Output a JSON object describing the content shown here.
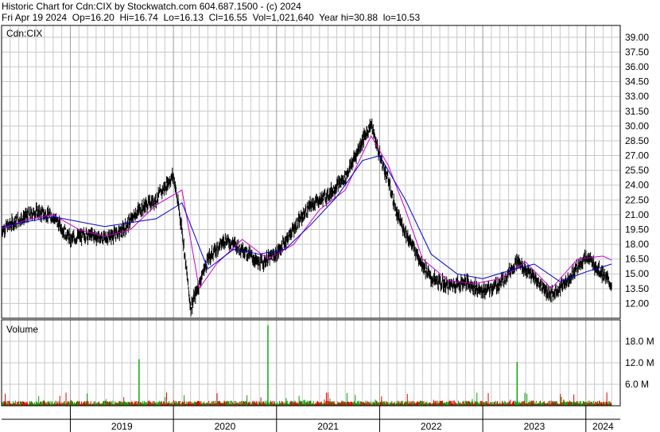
{
  "header": {
    "line1": "Historic Chart for Cdn:CIX by Stockwatch.com 604.687.1500 - (c) 2024",
    "date": "Fri Apr 19 2024",
    "op": "Op=16.20",
    "hi": "Hi=16.74",
    "lo": "Lo=16.13",
    "cl": "Cl=16.55",
    "vol": "Vol=1,021,640",
    "year_hi": "Year hi=30.88",
    "year_lo": "lo=10.53"
  },
  "price_panel": {
    "label": "Cdn:CIX"
  },
  "volume_panel": {
    "label": "Volume"
  },
  "colors": {
    "price_bars": "#000000",
    "ma_short": "#cc00cc",
    "ma_long": "#0000cc",
    "volume_up": "#00a000",
    "volume_down": "#e00000",
    "grid": "#c8c8c8",
    "frame": "#000000"
  },
  "chart_data": [
    {
      "type": "line",
      "title": "Historic Chart for Cdn:CIX",
      "xlabel": "",
      "ylabel": "",
      "x_tick_labels": [
        "2019",
        "2020",
        "2021",
        "2022",
        "2023",
        "2024"
      ],
      "y_tick_labels": [
        "12.00",
        "13.50",
        "15.00",
        "16.50",
        "18.00",
        "19.50",
        "21.00",
        "22.50",
        "24.00",
        "25.50",
        "27.00",
        "28.50",
        "30.00",
        "31.50",
        "33.00",
        "34.50",
        "36.00",
        "37.50",
        "39.00"
      ],
      "ylim": [
        10.5,
        40.2
      ],
      "xlim": [
        "2018-05",
        "2024-05"
      ],
      "grid": true,
      "series": [
        {
          "role": "price",
          "style": "daily high-low bars",
          "x": [
            "2018-05",
            "2018-07",
            "2018-09",
            "2018-11",
            "2019-01",
            "2019-03",
            "2019-05",
            "2019-07",
            "2019-09",
            "2019-11",
            "2020-01",
            "2020-02",
            "2020-03",
            "2020-04",
            "2020-05",
            "2020-07",
            "2020-09",
            "2020-11",
            "2021-01",
            "2021-03",
            "2021-05",
            "2021-07",
            "2021-09",
            "2021-11",
            "2021-12",
            "2022-01",
            "2022-02",
            "2022-03",
            "2022-05",
            "2022-07",
            "2022-09",
            "2022-11",
            "2023-01",
            "2023-03",
            "2023-05",
            "2023-07",
            "2023-09",
            "2023-11",
            "2024-01",
            "2024-03",
            "2024-04"
          ],
          "values": [
            19.5,
            20.5,
            21.3,
            20.8,
            18.5,
            19.0,
            18.6,
            19.3,
            21.5,
            22.6,
            25.0,
            19.5,
            11.5,
            14.0,
            16.5,
            18.5,
            17.6,
            16.0,
            17.0,
            19.6,
            22.0,
            23.0,
            24.8,
            28.5,
            30.2,
            27.0,
            24.5,
            21.0,
            17.5,
            14.5,
            13.8,
            14.2,
            13.2,
            14.0,
            16.3,
            14.5,
            12.8,
            14.5,
            16.8,
            15.0,
            13.8
          ]
        },
        {
          "role": "moving average (short)",
          "x": [
            "2018-05",
            "2018-08",
            "2018-11",
            "2019-02",
            "2019-05",
            "2019-08",
            "2019-11",
            "2020-02",
            "2020-04",
            "2020-06",
            "2020-09",
            "2020-12",
            "2021-03",
            "2021-06",
            "2021-09",
            "2021-12",
            "2022-02",
            "2022-04",
            "2022-06",
            "2022-09",
            "2022-12",
            "2023-03",
            "2023-06",
            "2023-09",
            "2023-12",
            "2024-03",
            "2024-04"
          ],
          "values": [
            19.6,
            20.5,
            21.0,
            19.5,
            18.8,
            19.5,
            22.0,
            23.5,
            13.5,
            16.0,
            18.5,
            16.5,
            18.0,
            21.5,
            23.5,
            29.0,
            26.0,
            21.5,
            16.5,
            14.3,
            14.0,
            14.5,
            16.2,
            13.5,
            16.5,
            16.8,
            16.4
          ]
        },
        {
          "role": "moving average (long)",
          "x": [
            "2018-05",
            "2018-11",
            "2019-05",
            "2019-11",
            "2020-02",
            "2020-05",
            "2020-08",
            "2020-11",
            "2021-02",
            "2021-05",
            "2021-08",
            "2021-11",
            "2022-01",
            "2022-04",
            "2022-07",
            "2022-10",
            "2023-01",
            "2023-04",
            "2023-07",
            "2023-10",
            "2024-01",
            "2024-04"
          ],
          "values": [
            19.8,
            20.8,
            19.8,
            20.6,
            22.2,
            15.5,
            17.5,
            17.0,
            17.5,
            20.0,
            22.8,
            26.5,
            27.0,
            22.5,
            17.0,
            15.0,
            14.5,
            15.3,
            16.0,
            14.2,
            15.2,
            16.0
          ]
        }
      ]
    },
    {
      "type": "bar",
      "title": "Volume",
      "xlabel": "",
      "ylabel": "",
      "y_tick_labels": [
        "6.0 M",
        "12.0 M",
        "18.0 M"
      ],
      "ylim": [
        0,
        24
      ],
      "grid": true,
      "typical_value_millions": 0.8,
      "spikes": [
        {
          "x": "2019-09",
          "value_millions": 13.0
        },
        {
          "x": "2020-12",
          "value_millions": 22.5
        },
        {
          "x": "2023-05",
          "value_millions": 12.2
        }
      ]
    }
  ]
}
